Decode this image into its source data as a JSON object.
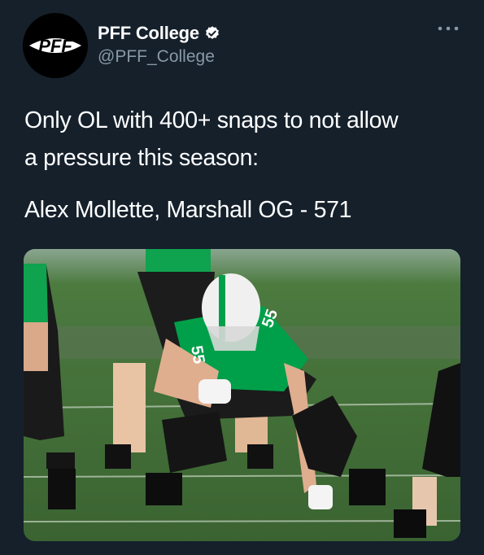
{
  "tweet": {
    "author": {
      "display_name": "PFF College",
      "handle": "@PFF_College",
      "avatar_text": "PFF",
      "verified": true
    },
    "text_lines": [
      "Only OL with 400+ snaps to not allow",
      "a pressure this season:",
      "Alex Mollette, Marshall OG - 571"
    ],
    "media": {
      "jersey_number": "55"
    }
  },
  "colors": {
    "background": "#15202b",
    "secondary_text": "#8899a6",
    "verified_badge": "#ffffff",
    "jersey": "#00a04a"
  },
  "icons": {
    "verified": "verified-badge-icon",
    "more": "more-dots-icon"
  }
}
